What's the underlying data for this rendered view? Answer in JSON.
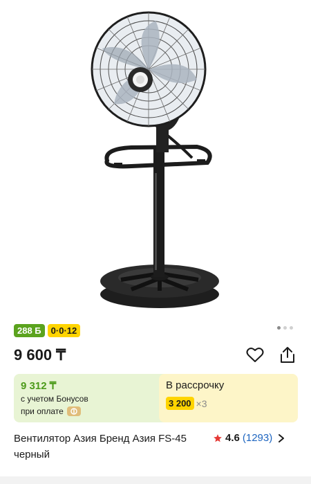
{
  "product": {
    "bonus_badge": "288 Б",
    "installment_badge": "0·0·12",
    "price": "9 600 ₸",
    "title": "Вентилятор Азия Бренд Азия FS-45 черный"
  },
  "gallery": {
    "image_name": "floor-fan-product-image",
    "total_images": 3,
    "active_index": 0
  },
  "bonus_card": {
    "price": "9 312 ₸",
    "line1": "с учетом Бонусов",
    "line2": "при оплате"
  },
  "installment_card": {
    "title": "В рассрочку",
    "amount": "3 200",
    "months": "×3"
  },
  "rating": {
    "value": "4.6",
    "count": "(1293)"
  },
  "colors": {
    "bonus_green": "#5ba31e",
    "installment_yellow": "#ffd400",
    "rating_star": "#e53935",
    "link_blue": "#1d65c0"
  }
}
